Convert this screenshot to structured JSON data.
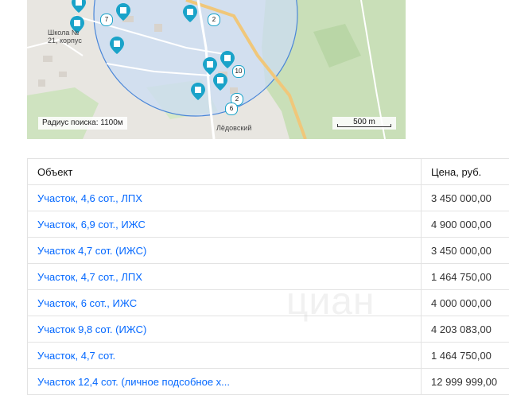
{
  "map": {
    "radius_label": "Радиус поиска: 1100м",
    "scale_label": "500 m",
    "place_labels": [
      "Школа № 21, корпус",
      "Лёдовский"
    ],
    "badges": [
      "2",
      "7",
      "10",
      "2",
      "6"
    ],
    "colors": {
      "circle_fill": "#cbdcf3",
      "circle_stroke": "#4a86d8",
      "pin": "#1aa3c9",
      "forest": "#c9dfb8"
    }
  },
  "table": {
    "headers": {
      "object": "Объект",
      "price": "Цена, руб."
    },
    "rows": [
      {
        "object": "Участок, 4,6 сот., ЛПХ",
        "price": "3 450 000,00"
      },
      {
        "object": "Участок, 6,9 сот., ИЖС",
        "price": "4 900 000,00"
      },
      {
        "object": "Участок 4,7 сот. (ИЖС)",
        "price": "3 450 000,00"
      },
      {
        "object": "Участок, 4,7 сот., ЛПХ",
        "price": "1 464 750,00"
      },
      {
        "object": "Участок, 6 сот., ИЖС",
        "price": "4 000 000,00"
      },
      {
        "object": "Участок 9,8 сот. (ИЖС)",
        "price": "4 203 083,00"
      },
      {
        "object": "Участок, 4,7 сот.",
        "price": "1 464 750,00"
      },
      {
        "object": "Участок 12,4 сот. (личное подсобное х...",
        "price": "12 999 999,00"
      }
    ],
    "colors": {
      "link": "#0468ff",
      "border": "#e3e3e3"
    }
  }
}
